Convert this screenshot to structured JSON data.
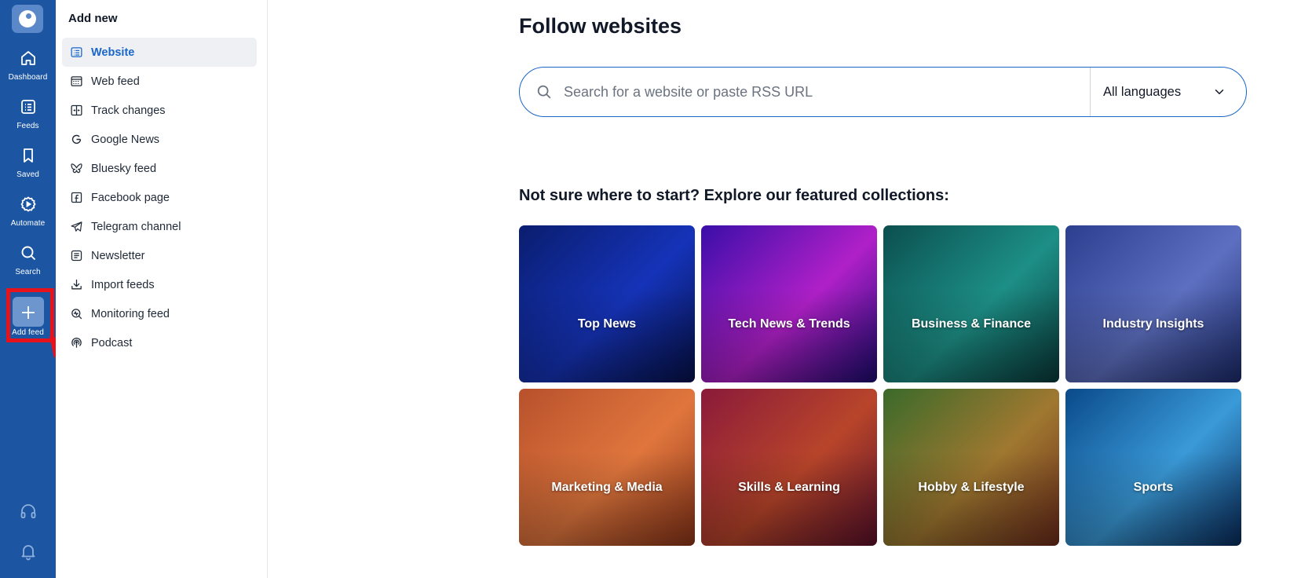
{
  "rail": {
    "items": [
      {
        "label": "Dashboard",
        "icon": "home-icon"
      },
      {
        "label": "Feeds",
        "icon": "feeds-icon"
      },
      {
        "label": "Saved",
        "icon": "bookmark-icon"
      },
      {
        "label": "Automate",
        "icon": "automate-icon"
      },
      {
        "label": "Search",
        "icon": "search-icon"
      },
      {
        "label": "Add feed",
        "icon": "plus-icon"
      }
    ],
    "bottom_icons": [
      "headset-icon",
      "bell-icon"
    ],
    "accent": "#1c56a3"
  },
  "panel": {
    "title": "Add new",
    "items": [
      {
        "label": "Website",
        "icon": "website-icon",
        "active": true
      },
      {
        "label": "Web feed",
        "icon": "web-feed-icon"
      },
      {
        "label": "Track changes",
        "icon": "track-changes-icon"
      },
      {
        "label": "Google News",
        "icon": "google-icon"
      },
      {
        "label": "Bluesky feed",
        "icon": "butterfly-icon"
      },
      {
        "label": "Facebook page",
        "icon": "facebook-icon"
      },
      {
        "label": "Telegram channel",
        "icon": "telegram-icon"
      },
      {
        "label": "Newsletter",
        "icon": "newsletter-icon"
      },
      {
        "label": "Import feeds",
        "icon": "import-icon"
      },
      {
        "label": "Monitoring feed",
        "icon": "monitoring-icon"
      },
      {
        "label": "Podcast",
        "icon": "podcast-icon"
      }
    ]
  },
  "main": {
    "title": "Follow websites",
    "search": {
      "placeholder": "Search for a website or paste RSS URL"
    },
    "language": {
      "selected": "All languages"
    },
    "collections_title": "Not sure where to start? Explore our featured collections:",
    "collections": [
      {
        "label": "Top News",
        "colors": [
          "#0a1d6e",
          "#1533b8",
          "#06104a"
        ]
      },
      {
        "label": "Tech News & Trends",
        "colors": [
          "#3a0ea8",
          "#b020c8",
          "#1a0a70"
        ]
      },
      {
        "label": "Business & Finance",
        "colors": [
          "#0b4f4f",
          "#1d8f86",
          "#083838"
        ]
      },
      {
        "label": "Industry Insights",
        "colors": [
          "#2c3f8f",
          "#5d6fc0",
          "#1a2a6a"
        ]
      },
      {
        "label": "Marketing & Media",
        "colors": [
          "#b8512c",
          "#e0763d",
          "#8a3418"
        ]
      },
      {
        "label": "Skills & Learning",
        "colors": [
          "#8a1a3a",
          "#b8452a",
          "#5a0f2a"
        ]
      },
      {
        "label": "Hobby & Lifestyle",
        "colors": [
          "#3a6a2a",
          "#a07830",
          "#6a2a1a"
        ]
      },
      {
        "label": "Sports",
        "colors": [
          "#0a4a8a",
          "#3a9ad8",
          "#082a5a"
        ]
      }
    ]
  },
  "annotation": {
    "highlight_color": "#e8121b"
  }
}
